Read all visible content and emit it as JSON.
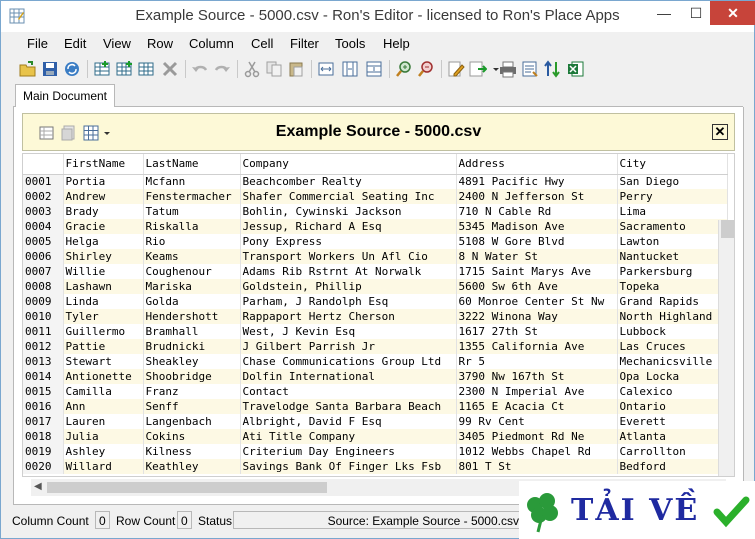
{
  "window": {
    "title": "Example Source - 5000.csv - Ron's Editor - licensed to Ron's Place Apps",
    "minimize_glyph": "—",
    "maximize_glyph": "☐",
    "close_glyph": "✕"
  },
  "menu": [
    "File",
    "Edit",
    "View",
    "Row",
    "Column",
    "Cell",
    "Filter",
    "Tools",
    "Help"
  ],
  "toolbar": {
    "icons": [
      "open-icon",
      "save-icon",
      "refresh-icon",
      "insert-row-icon",
      "insert-column-icon",
      "grid-icon",
      "delete-icon",
      "undo-icon",
      "redo-icon",
      "cut-icon",
      "copy-icon",
      "paste-icon",
      "fit-width-icon",
      "fit-columns-icon",
      "fit-rows-icon",
      "zoom-in-icon",
      "zoom-out-icon",
      "edit-icon",
      "export-icon",
      "print-icon",
      "properties-icon",
      "sort-icon",
      "excel-icon"
    ]
  },
  "tabs": [
    {
      "label": "Main Document"
    }
  ],
  "document": {
    "title": "Example Source - 5000.csv",
    "close_glyph": "✕"
  },
  "table": {
    "columns": [
      "FirstName",
      "LastName",
      "Company",
      "Address",
      "City"
    ],
    "rows": [
      {
        "num": "0001",
        "cells": [
          "Portia",
          "Mcfann",
          "Beachcomber Realty",
          "4891 Pacific Hwy",
          "San Diego"
        ]
      },
      {
        "num": "0002",
        "cells": [
          "Andrew",
          "Fenstermacher",
          "Shafer Commercial Seating Inc",
          "2400 N Jefferson St",
          "Perry"
        ]
      },
      {
        "num": "0003",
        "cells": [
          "Brady",
          "Tatum",
          "Bohlin, Cywinski Jackson",
          "710 N Cable Rd",
          "Lima"
        ]
      },
      {
        "num": "0004",
        "cells": [
          "Gracie",
          "Riskalla",
          "Jessup, Richard A Esq",
          "5345 Madison Ave",
          "Sacramento"
        ]
      },
      {
        "num": "0005",
        "cells": [
          "Helga",
          "Rio",
          "Pony Express",
          "5108 W Gore Blvd",
          "Lawton"
        ]
      },
      {
        "num": "0006",
        "cells": [
          "Shirley",
          "Keams",
          "Transport Workers Un Afl Cio",
          "8 N Water St",
          "Nantucket"
        ]
      },
      {
        "num": "0007",
        "cells": [
          "Willie",
          "Coughenour",
          "Adams Rib Rstrnt At Norwalk",
          "1715 Saint Marys Ave",
          "Parkersburg"
        ]
      },
      {
        "num": "0008",
        "cells": [
          "Lashawn",
          "Mariska",
          "Goldstein, Phillip",
          "5600 Sw 6th Ave",
          "Topeka"
        ]
      },
      {
        "num": "0009",
        "cells": [
          "Linda",
          "Golda",
          "Parham, J Randolph Esq",
          "60 Monroe Center St Nw",
          "Grand Rapids"
        ]
      },
      {
        "num": "0010",
        "cells": [
          "Tyler",
          "Hendershott",
          "Rappaport Hertz Cherson",
          "3222 Winona Way",
          "North Highland"
        ]
      },
      {
        "num": "0011",
        "cells": [
          "Guillermo",
          "Bramhall",
          "West, J Kevin Esq",
          "1617 27th St",
          "Lubbock"
        ]
      },
      {
        "num": "0012",
        "cells": [
          "Pattie",
          "Brudnicki",
          "J Gilbert Parrish Jr",
          "1355 California Ave",
          "Las Cruces"
        ]
      },
      {
        "num": "0013",
        "cells": [
          "Stewart",
          "Sheakley",
          "Chase Communications Group Ltd",
          "Rr 5",
          "Mechanicsville"
        ]
      },
      {
        "num": "0014",
        "cells": [
          "Antionette",
          "Shoobridge",
          "Dolfin International",
          "3790 Nw 167th St",
          "Opa Locka"
        ]
      },
      {
        "num": "0015",
        "cells": [
          "Camilla",
          "Franz",
          "Contact",
          "2300 N Imperial Ave",
          "Calexico"
        ]
      },
      {
        "num": "0016",
        "cells": [
          "Ann",
          "Senff",
          "Travelodge Santa Barbara Beach",
          "1165 E Acacia Ct",
          "Ontario"
        ]
      },
      {
        "num": "0017",
        "cells": [
          "Lauren",
          "Langenbach",
          "Albright, David F Esq",
          "99 Rv Cent",
          "Everett"
        ]
      },
      {
        "num": "0018",
        "cells": [
          "Julia",
          "Cokins",
          "Ati Title Company",
          "3405 Piedmont Rd Ne",
          "Atlanta"
        ]
      },
      {
        "num": "0019",
        "cells": [
          "Ashley",
          "Kilness",
          "Criterium Day Engineers",
          "1012 Webbs Chapel Rd",
          "Carrollton"
        ]
      },
      {
        "num": "0020",
        "cells": [
          "Willard",
          "Keathley",
          "Savings Bank Of Finger Lks Fsb",
          "801 T St",
          "Bedford"
        ]
      }
    ]
  },
  "status": {
    "column_count_label": "Column Count",
    "column_count_value": "0",
    "row_count_label": "Row Count",
    "row_count_value": "0",
    "status_label": "Status",
    "source_text": "Source: Example Source - 5000.csv"
  },
  "watermark": {
    "text": "TẢI VỀ"
  }
}
